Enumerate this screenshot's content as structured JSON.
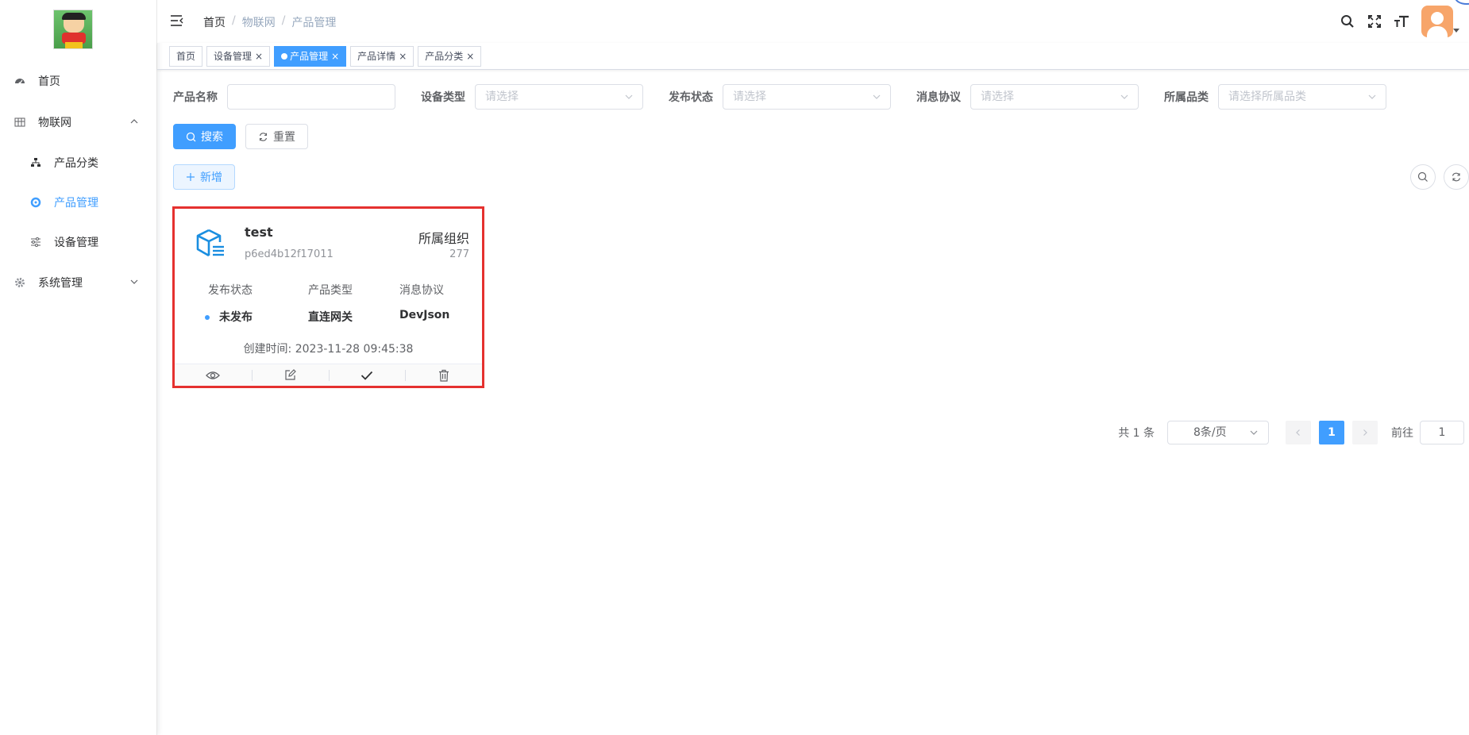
{
  "sidebar": {
    "items": [
      {
        "label": "首页",
        "icon": "dashboard-icon"
      },
      {
        "label": "物联网",
        "icon": "grid-icon",
        "expanded": true
      },
      {
        "label": "产品分类",
        "icon": "tree-icon"
      },
      {
        "label": "产品管理",
        "icon": "product-icon",
        "active": true
      },
      {
        "label": "设备管理",
        "icon": "sliders-icon"
      },
      {
        "label": "系统管理",
        "icon": "gear-icon",
        "expanded": false
      }
    ]
  },
  "header": {
    "breadcrumb": [
      "首页",
      "物联网",
      "产品管理"
    ],
    "separator": "/"
  },
  "tags": [
    {
      "label": "首页",
      "closable": false
    },
    {
      "label": "设备管理",
      "closable": true
    },
    {
      "label": "产品管理",
      "closable": true,
      "active": true
    },
    {
      "label": "产品详情",
      "closable": true
    },
    {
      "label": "产品分类",
      "closable": true
    }
  ],
  "filters": {
    "product_name": {
      "label": "产品名称",
      "value": "",
      "placeholder": ""
    },
    "device_type": {
      "label": "设备类型",
      "placeholder": "请选择"
    },
    "publish_status": {
      "label": "发布状态",
      "placeholder": "请选择"
    },
    "protocol": {
      "label": "消息协议",
      "placeholder": "请选择"
    },
    "category": {
      "label": "所属品类",
      "placeholder": "请选择所属品类"
    }
  },
  "buttons": {
    "search": "搜索",
    "reset": "重置",
    "add": "新增"
  },
  "card": {
    "name": "test",
    "code": "p6ed4b12f17011",
    "org_label": "所属组织",
    "org_value": "277",
    "status_label": "发布状态",
    "status_value": "未发布",
    "type_label": "产品类型",
    "type_value": "直连网关",
    "protocol_label": "消息协议",
    "protocol_value": "DevJson",
    "created": "创建时间: 2023-11-28 09:45:38"
  },
  "pagination": {
    "total": "共 1 条",
    "page_size": "8条/页",
    "current_page": "1",
    "goto_label": "前往",
    "goto_value": "1"
  },
  "colors": {
    "primary": "#409eff",
    "highlight_border": "#e5312f"
  }
}
